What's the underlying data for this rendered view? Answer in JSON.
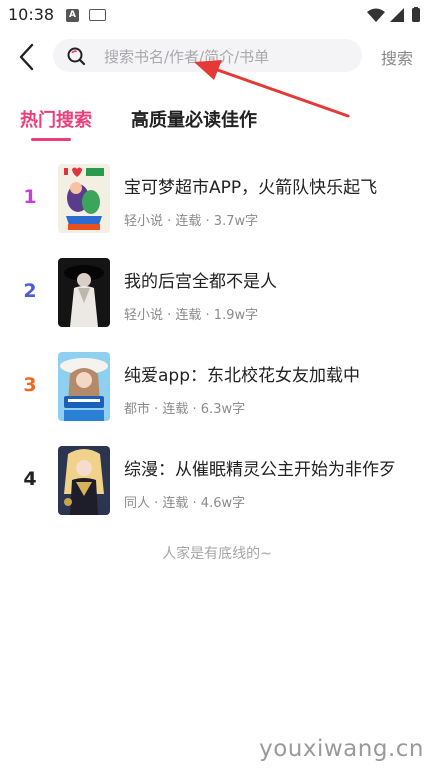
{
  "status_bar": {
    "time": "10:38",
    "a_badge": "A"
  },
  "search": {
    "placeholder": "搜索书名/作者/简介/书单",
    "button_label": "搜索"
  },
  "tabs": [
    {
      "label": "热门搜索",
      "active": true
    },
    {
      "label": "高质量必读佳作",
      "active": false
    }
  ],
  "books": [
    {
      "rank": "1",
      "rank_color": "#c63fd6",
      "title": "宝可梦超市APP，火箭队快乐起飞",
      "meta": "轻小说 · 连载 · 3.7w字"
    },
    {
      "rank": "2",
      "rank_color": "#4a5bd8",
      "title": "我的后宫全都不是人",
      "meta": "轻小说 · 连载 · 1.9w字"
    },
    {
      "rank": "3",
      "rank_color": "#f2661c",
      "title": "纯爱app：东北校花女友加载中",
      "meta": "都市 · 连载 · 6.3w字"
    },
    {
      "rank": "4",
      "rank_color": "#222222",
      "title": "综漫：从催眠精灵公主开始为非作歹",
      "meta": "同人 · 连载 · 4.6w字"
    }
  ],
  "footer_note": "人家是有底线的~",
  "watermark": "youxiwang.cn",
  "colors": {
    "accent": "#ec3f7c",
    "annotation_arrow": "#e53935"
  }
}
